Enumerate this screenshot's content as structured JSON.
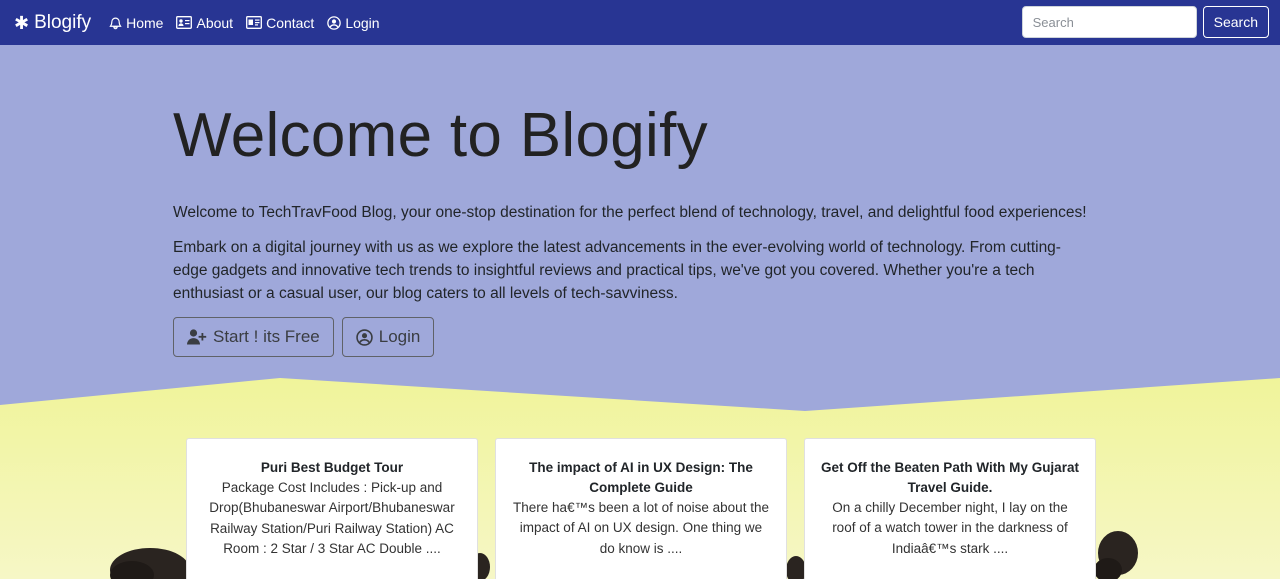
{
  "navbar": {
    "brand": "Blogify",
    "items": [
      {
        "label": "Home",
        "icon": "bell-icon"
      },
      {
        "label": "About",
        "icon": "id-card-icon"
      },
      {
        "label": "Contact",
        "icon": "address-card-icon"
      },
      {
        "label": "Login",
        "icon": "user-circle-icon"
      }
    ],
    "search_placeholder": "Search",
    "search_button": "Search"
  },
  "hero": {
    "title": "Welcome to Blogify",
    "lead1": "Welcome to TechTravFood Blog, your one-stop destination for the perfect blend of technology, travel, and delightful food experiences!",
    "lead2": "Embark on a digital journey with us as we explore the latest advancements in the ever-evolving world of technology. From cutting-edge gadgets and innovative tech trends to insightful reviews and practical tips, we've got you covered. Whether you're a tech enthusiast or a casual user, our blog caters to all levels of tech-savviness.",
    "start_button": "Start ! its Free",
    "login_button": "Login"
  },
  "cards": [
    {
      "title": "Puri Best Budget Tour",
      "text": "Package Cost Includes : Pick-up and Drop(Bhubaneswar Airport/Bhubaneswar Railway Station/Puri Railway Station) AC Room : 2 Star / 3 Star AC Double ...."
    },
    {
      "title": "The impact of AI in UX Design: The Complete Guide",
      "text": "There ha€™s been a lot of noise about the impact of AI on UX design. One thing we do know is ...."
    },
    {
      "title": "Get Off the Beaten Path With My Gujarat Travel Guide.",
      "text": "On a chilly December night, I lay on the roof of a watch tower in the darkness of Indiaâ€™s stark ...."
    }
  ],
  "colors": {
    "navbar": "#283593",
    "hero_bg": "#9fa8da",
    "field_yellow": "#eef39a"
  }
}
